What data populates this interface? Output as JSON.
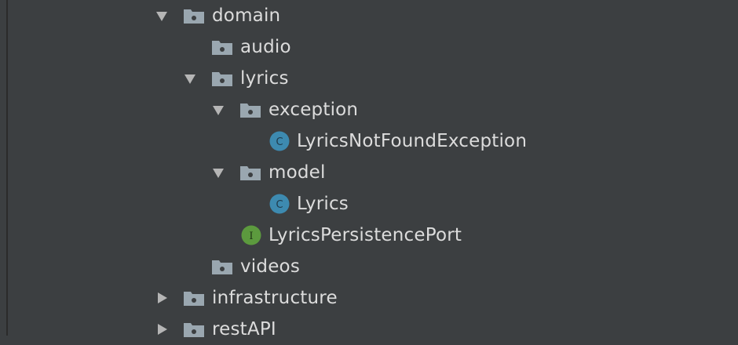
{
  "project_tree": {
    "items": [
      {
        "label": "domain",
        "type": "folder",
        "state": "expanded"
      },
      {
        "label": "audio",
        "type": "folder",
        "state": "leaf"
      },
      {
        "label": "lyrics",
        "type": "folder",
        "state": "expanded"
      },
      {
        "label": "exception",
        "type": "folder",
        "state": "expanded"
      },
      {
        "label": "LyricsNotFoundException",
        "type": "class",
        "badge": "C"
      },
      {
        "label": "model",
        "type": "folder",
        "state": "expanded"
      },
      {
        "label": "Lyrics",
        "type": "class",
        "badge": "C"
      },
      {
        "label": "LyricsPersistencePort",
        "type": "interface",
        "badge": "I"
      },
      {
        "label": "videos",
        "type": "folder",
        "state": "leaf"
      },
      {
        "label": "infrastructure",
        "type": "folder",
        "state": "collapsed"
      },
      {
        "label": "restAPI",
        "type": "folder",
        "state": "collapsed"
      }
    ]
  },
  "colors": {
    "background": "#3c3f41",
    "text": "#dcdcdc",
    "folder": "#9aa7b0",
    "class_badge": "#3d8ab0",
    "interface_badge": "#5c9a3e"
  }
}
